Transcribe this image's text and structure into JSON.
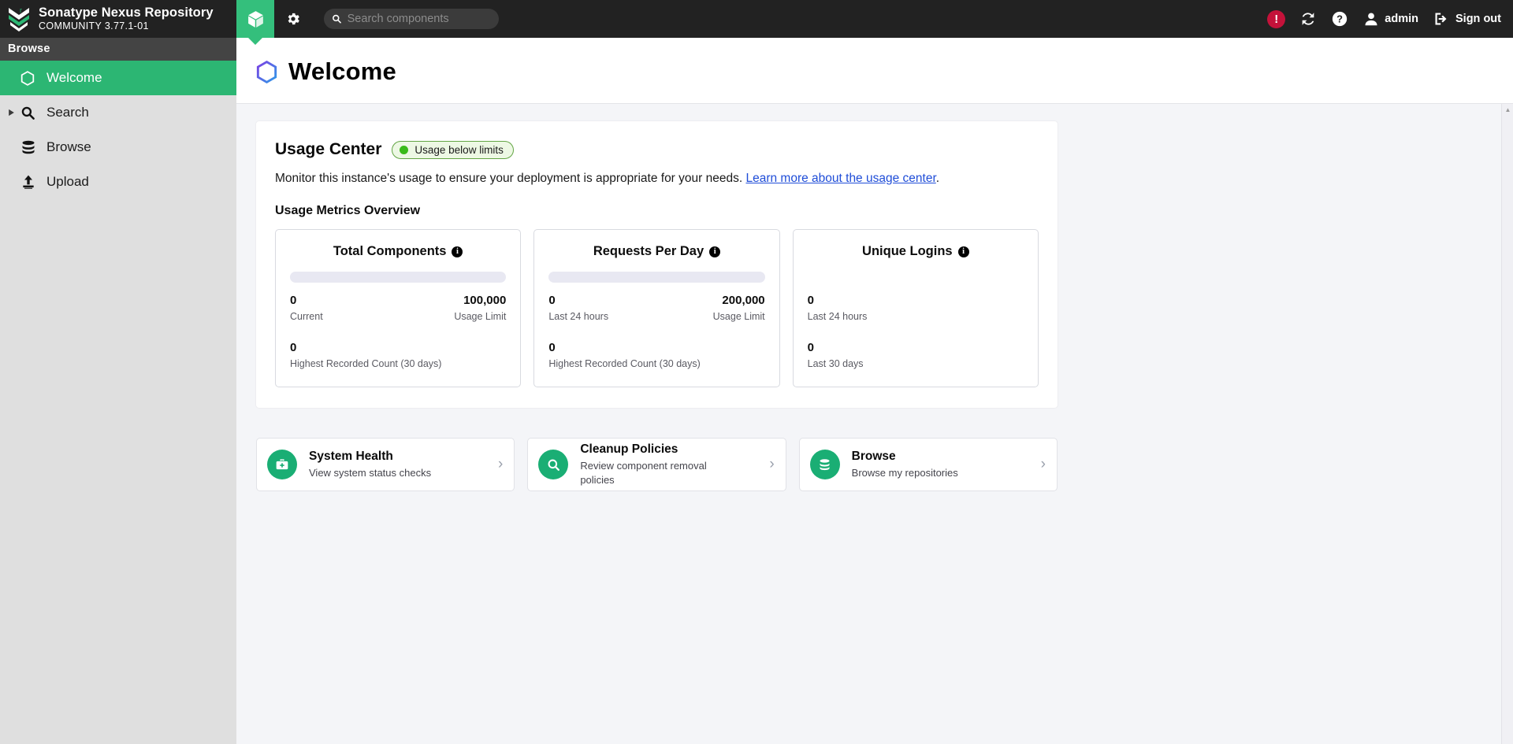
{
  "header": {
    "brand_title": "Sonatype Nexus Repository",
    "brand_subtitle": "COMMUNITY 3.77.1-01",
    "cube_tab_icon": "cube-icon",
    "gear_icon": "gear-icon",
    "search_placeholder": "Search components",
    "search_value": "",
    "search_icon": "search-icon",
    "alert_icon": "alert-icon",
    "alert_glyph": "!",
    "refresh_icon": "refresh-icon",
    "help_icon": "help-icon",
    "user_icon": "user-icon",
    "user_name": "admin",
    "signout_icon": "signout-icon",
    "signout_label": "Sign out"
  },
  "sidebar": {
    "section_title": "Browse",
    "items": [
      {
        "label": "Welcome",
        "icon": "hexagon-icon",
        "active": true,
        "expandable": false
      },
      {
        "label": "Search",
        "icon": "search-icon",
        "active": false,
        "expandable": true
      },
      {
        "label": "Browse",
        "icon": "database-icon",
        "active": false,
        "expandable": false
      },
      {
        "label": "Upload",
        "icon": "upload-icon",
        "active": false,
        "expandable": false
      }
    ]
  },
  "page": {
    "title": "Welcome",
    "title_icon": "hexagon-icon"
  },
  "usage_center": {
    "title": "Usage Center",
    "status_badge": "Usage below limits",
    "description_before_link": "Monitor this instance's usage to ensure your deployment is appropriate for your needs. ",
    "link_text": "Learn more about the usage center",
    "description_after_link": ".",
    "metrics_heading": "Usage Metrics Overview",
    "info_glyph": "i",
    "metrics": [
      {
        "title": "Total Components",
        "has_progress": true,
        "progress_percent": 0,
        "primary_value": "0",
        "primary_label": "Current",
        "limit_value": "100,000",
        "limit_label": "Usage Limit",
        "secondary_value": "0",
        "secondary_label": "Highest Recorded Count (30 days)"
      },
      {
        "title": "Requests Per Day",
        "has_progress": true,
        "progress_percent": 0,
        "primary_value": "0",
        "primary_label": "Last 24 hours",
        "limit_value": "200,000",
        "limit_label": "Usage Limit",
        "secondary_value": "0",
        "secondary_label": "Highest Recorded Count (30 days)"
      },
      {
        "title": "Unique Logins",
        "has_progress": false,
        "progress_percent": 0,
        "primary_value": "0",
        "primary_label": "Last 24 hours",
        "limit_value": "",
        "limit_label": "",
        "secondary_value": "0",
        "secondary_label": "Last 30 days"
      }
    ]
  },
  "action_cards": [
    {
      "title": "System Health",
      "subtitle": "View system status checks",
      "icon": "medical-bag-icon",
      "chevron": "›"
    },
    {
      "title": "Cleanup Policies",
      "subtitle": "Review component removal policies",
      "icon": "search-icon",
      "chevron": "›"
    },
    {
      "title": "Browse",
      "subtitle": "Browse my repositories",
      "icon": "database-icon",
      "chevron": "›"
    }
  ],
  "colors": {
    "brand_green": "#34bf7c",
    "sidebar_active": "#2cb673",
    "header_bg": "#222222",
    "alert_red": "#c4123a",
    "link_blue": "#1f4dd8",
    "badge_green": "#3aba1a",
    "action_icon_green": "#1aae74"
  },
  "scrollbar": {
    "up_arrow": "▲"
  }
}
